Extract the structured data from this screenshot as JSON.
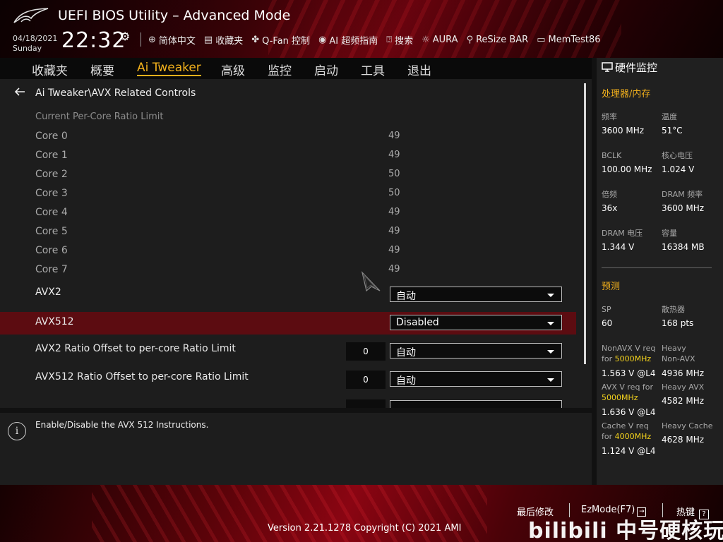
{
  "header": {
    "title": "UEFI BIOS Utility – Advanced Mode",
    "date": "04/18/2021",
    "day": "Sunday",
    "time": "22:32",
    "tools": [
      {
        "label": "简体中文",
        "icon": "globe-icon"
      },
      {
        "label": "收藏夹",
        "icon": "favorites-icon"
      },
      {
        "label": "Q-Fan 控制",
        "icon": "fan-icon"
      },
      {
        "label": "AI 超频指南",
        "icon": "ai-icon"
      },
      {
        "label": "搜索",
        "icon": "search-help-icon"
      },
      {
        "label": "AURA",
        "icon": "aura-icon"
      },
      {
        "label": "ReSize BAR",
        "icon": "resize-bar-icon"
      },
      {
        "label": "MemTest86",
        "icon": "memtest-icon"
      }
    ]
  },
  "nav": {
    "tabs": [
      "收藏夹",
      "概要",
      "Ai Tweaker",
      "高级",
      "监控",
      "启动",
      "工具",
      "退出"
    ],
    "active": "Ai Tweaker"
  },
  "main": {
    "breadcrumb": "Ai Tweaker\\AVX Related Controls",
    "subheader": "Current Per-Core Ratio Limit",
    "cores": [
      {
        "label": "Core 0",
        "value": "49"
      },
      {
        "label": "Core 1",
        "value": "49"
      },
      {
        "label": "Core 2",
        "value": "50"
      },
      {
        "label": "Core 3",
        "value": "50"
      },
      {
        "label": "Core 4",
        "value": "49"
      },
      {
        "label": "Core 5",
        "value": "49"
      },
      {
        "label": "Core 6",
        "value": "49"
      },
      {
        "label": "Core 7",
        "value": "49"
      }
    ],
    "settings": [
      {
        "label": "AVX2",
        "value": "自动",
        "number": ""
      },
      {
        "label": "AVX512",
        "value": "Disabled",
        "number": ""
      },
      {
        "label": "AVX2 Ratio Offset to per-core Ratio Limit",
        "value": "自动",
        "number": "0"
      },
      {
        "label": "AVX512 Ratio Offset to per-core Ratio Limit",
        "value": "自动",
        "number": "0"
      }
    ]
  },
  "help": {
    "text": "Enable/Disable the AVX 512 Instructions."
  },
  "sidebar": {
    "title": "硬件监控",
    "cpu_section": "处理器/内存",
    "cpu_items": [
      {
        "k": "频率",
        "v": "3600 MHz"
      },
      {
        "k": "温度",
        "v": "51°C"
      },
      {
        "k": "BCLK",
        "v": "100.00 MHz"
      },
      {
        "k": "核心电压",
        "v": "1.024 V"
      },
      {
        "k": "倍频",
        "v": "36x"
      },
      {
        "k": "DRAM 频率",
        "v": "3600 MHz"
      },
      {
        "k": "DRAM 电压",
        "v": "1.344 V"
      },
      {
        "k": "容量",
        "v": "16384 MB"
      }
    ],
    "predict_section": "预测",
    "sp_label": "SP",
    "sp_value": "60",
    "cooler_label": "散热器",
    "cooler_value": "168 pts",
    "nonavx_label": "NonAVX V req for",
    "nonavx_freq": "5000MHz",
    "nonavx_value": "1.563 V @L4",
    "heavy_nonavx_label": "Heavy Non-AVX",
    "heavy_nonavx_value": "4936 MHz",
    "avx_label": "AVX V req for",
    "avx_freq": "5000MHz",
    "avx_value": "1.636 V @L4",
    "heavy_avx_label": "Heavy AVX",
    "heavy_avx_value": "4582 MHz",
    "cache_label": "Cache V req for",
    "cache_freq": "4000MHz",
    "cache_value": "1.124 V @L4",
    "heavy_cache_label": "Heavy Cache",
    "heavy_cache_value": "4628 MHz"
  },
  "footer": {
    "last_modified": "最后修改",
    "ezmode": "EzMode(F7)",
    "hotkeys": "热键",
    "version": "Version 2.21.1278 Copyright (C) 2021 AMI",
    "watermark": "bilibili 中号硬核玩家"
  },
  "colors": {
    "accent": "#f3b11c",
    "selected_row": "#5c0c11",
    "panel": "#1d1d1d"
  }
}
